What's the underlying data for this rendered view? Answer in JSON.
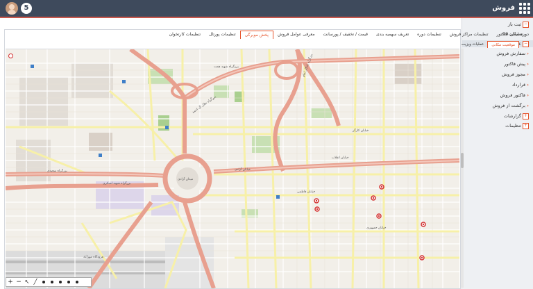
{
  "topbar": {
    "app_title": "فروش",
    "logo_glyph": "5"
  },
  "sidebar": {
    "items": [
      {
        "label": "ثبت باز",
        "icon": "box"
      },
      {
        "label": "دوره مالی 99",
        "icon": ""
      },
      {
        "label": "عملیات",
        "icon": "box"
      },
      {
        "label": "سفارش فروش",
        "icon": "arrow"
      },
      {
        "label": "پیش فاکتور",
        "icon": "arrow"
      },
      {
        "label": "مجوز فروش",
        "icon": "arrow"
      },
      {
        "label": "قرارداد",
        "icon": "arrow"
      },
      {
        "label": "فاکتور فروش",
        "icon": "arrow"
      },
      {
        "label": "برگشت از فروش",
        "icon": "arrow"
      },
      {
        "label": "گزارشات",
        "icon": "box"
      },
      {
        "label": "تنظیمات",
        "icon": "box"
      }
    ]
  },
  "tabs": [
    {
      "label": "تنظیمات فاکتور"
    },
    {
      "label": "تنظیمات مراکز فروش"
    },
    {
      "label": "تنظیمات دوره"
    },
    {
      "label": "تعریف سهمیه بندی"
    },
    {
      "label": "قیمت / تخفیف / پورسانت"
    },
    {
      "label": "معرفی عوامل فروش"
    },
    {
      "label": "پخش مویرگی"
    },
    {
      "label": "تنظیمات پورتال"
    },
    {
      "label": "تنظیمات کارتخوان"
    }
  ],
  "subtabs": [
    {
      "label": "موقعیت مکانی"
    },
    {
      "label": "عملیات ویزیت"
    }
  ],
  "map": {
    "labels": [
      {
        "text": "بزرگراه شهید همت"
      },
      {
        "text": "بزرگراه جلال آل احمد"
      },
      {
        "text": "خیابان آزادی"
      },
      {
        "text": "میدان آزادی"
      },
      {
        "text": "بزرگراه سعیدی"
      },
      {
        "text": "بزرگراه شهید لشکری"
      },
      {
        "text": "خیابان انقلاب"
      },
      {
        "text": "خیابان کارگر"
      },
      {
        "text": "خیابان فاطمی"
      },
      {
        "text": "خیابان جمهوری"
      },
      {
        "text": "بزرگراه یادگار امام"
      },
      {
        "text": "فرودگاه مهرآباد"
      }
    ],
    "markers": 7
  },
  "colors": {
    "topbar": "#3e4a5c",
    "accent": "#e6532a",
    "marker": "#d32f2f"
  }
}
